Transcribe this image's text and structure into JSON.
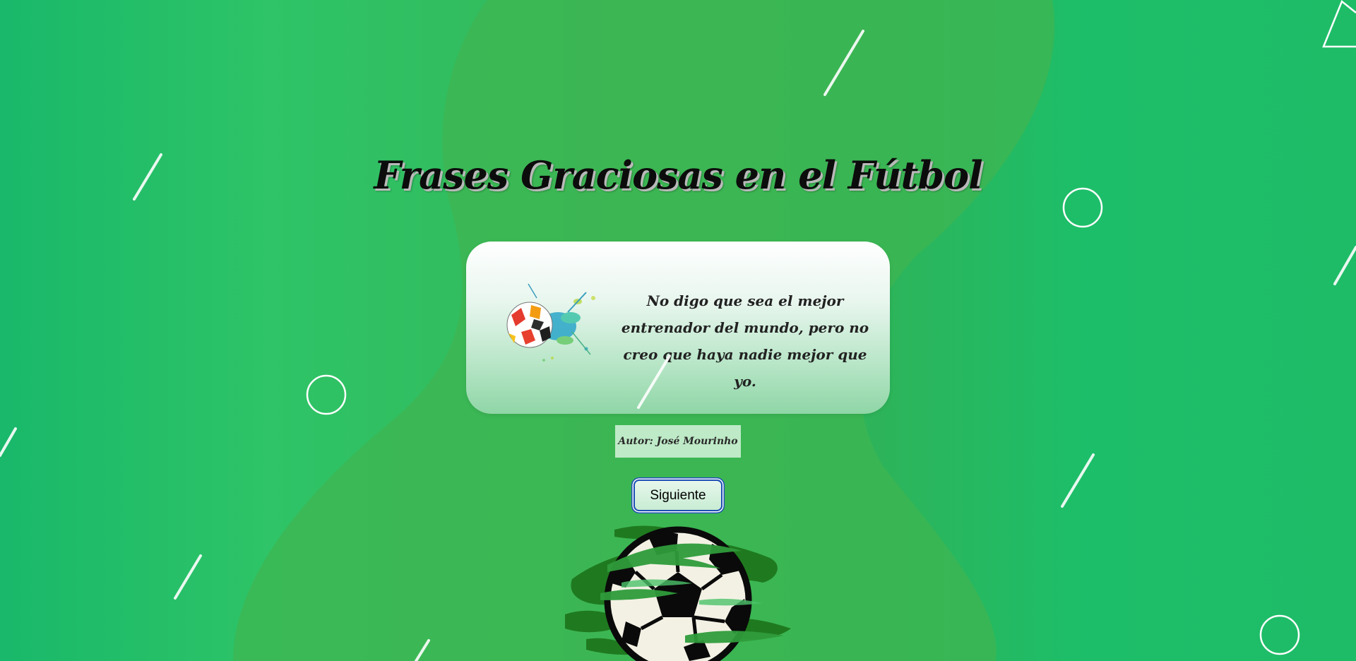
{
  "page": {
    "title": "Frases Graciosas en el Fútbol"
  },
  "quote_card": {
    "image_icon": "splash-soccer-ball-icon",
    "text": "No digo que sea el mejor entrenador del mundo, pero no creo que haya nadie mejor que yo."
  },
  "author": {
    "label": "Autor: José Mourinho"
  },
  "buttons": {
    "next_label": "Siguiente"
  },
  "decor": {
    "footer_icon": "soccer-ball-icon",
    "shapes": [
      "triangle-icon",
      "circle-icon",
      "line-streak-icon"
    ]
  },
  "colors": {
    "background_green": "#1fbc68",
    "blob_green": "#3fb552",
    "focus_blue": "#1f4fb5"
  }
}
